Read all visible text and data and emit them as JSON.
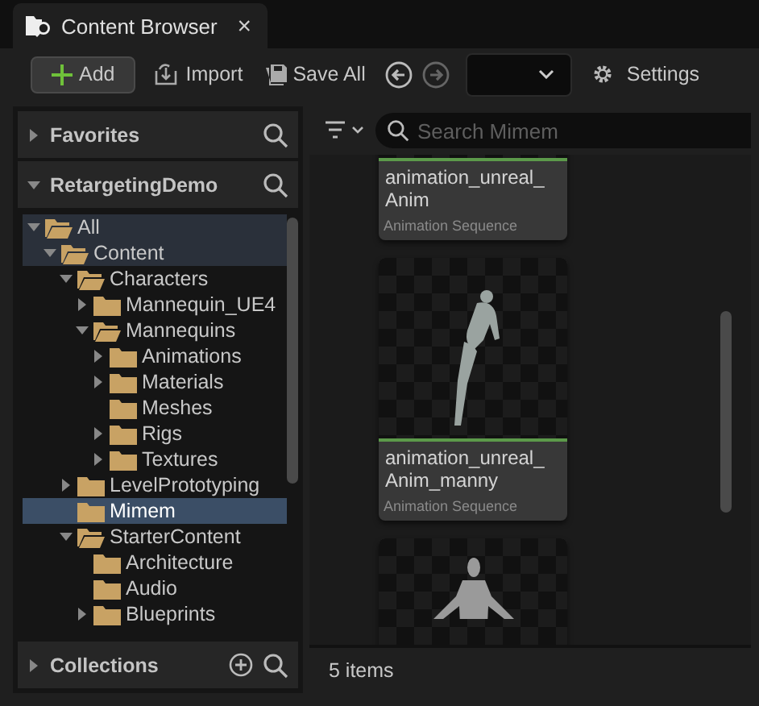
{
  "tab": {
    "title": "Content Browser",
    "close": "×"
  },
  "toolbar": {
    "add": "Add",
    "import": "Import",
    "save_all": "Save All",
    "back_disabled": false,
    "forward_disabled": true,
    "settings": "Settings"
  },
  "favorites": {
    "title": "Favorites",
    "expanded": false
  },
  "project": {
    "title": "RetargetingDemo",
    "expanded": true
  },
  "tree": [
    {
      "label": "All",
      "expanded": true,
      "selected": false,
      "highlighted": true,
      "children": [
        {
          "label": "Content",
          "expanded": true,
          "selected": false,
          "highlighted": true,
          "children": [
            {
              "label": "Characters",
              "expanded": true,
              "selected": false,
              "highlighted": false,
              "children": [
                {
                  "label": "Mannequin_UE4",
                  "expanded": false,
                  "selected": false,
                  "highlighted": false
                },
                {
                  "label": "Mannequins",
                  "expanded": true,
                  "selected": false,
                  "highlighted": false,
                  "children": [
                    {
                      "label": "Animations",
                      "expanded": false,
                      "selected": false,
                      "highlighted": false
                    },
                    {
                      "label": "Materials",
                      "expanded": false,
                      "selected": false,
                      "highlighted": false
                    },
                    {
                      "label": "Meshes",
                      "selected": false,
                      "highlighted": false
                    },
                    {
                      "label": "Rigs",
                      "expanded": false,
                      "selected": false,
                      "highlighted": false
                    },
                    {
                      "label": "Textures",
                      "expanded": false,
                      "selected": false,
                      "highlighted": false
                    }
                  ]
                }
              ]
            },
            {
              "label": "LevelPrototyping",
              "expanded": false,
              "selected": false,
              "highlighted": false
            },
            {
              "label": "Mimem",
              "selected": true,
              "highlighted": false
            },
            {
              "label": "StarterContent",
              "expanded": true,
              "selected": false,
              "highlighted": false,
              "children": [
                {
                  "label": "Architecture",
                  "selected": false,
                  "highlighted": false
                },
                {
                  "label": "Audio",
                  "selected": false,
                  "highlighted": false
                },
                {
                  "label": "Blueprints",
                  "expanded": false,
                  "selected": false,
                  "highlighted": false
                }
              ]
            }
          ]
        }
      ]
    }
  ],
  "collections": {
    "title": "Collections",
    "expanded": false
  },
  "filter": {
    "placeholder": "Search Mimem"
  },
  "assets": [
    {
      "kind": "clipped-top",
      "name": "animation_unreal_Anim",
      "type": "Animation Sequence"
    },
    {
      "kind": "full",
      "name": "animation_unreal_Anim_manny",
      "type": "Animation Sequence"
    },
    {
      "kind": "clipped-bottom"
    }
  ],
  "status": "5 items"
}
